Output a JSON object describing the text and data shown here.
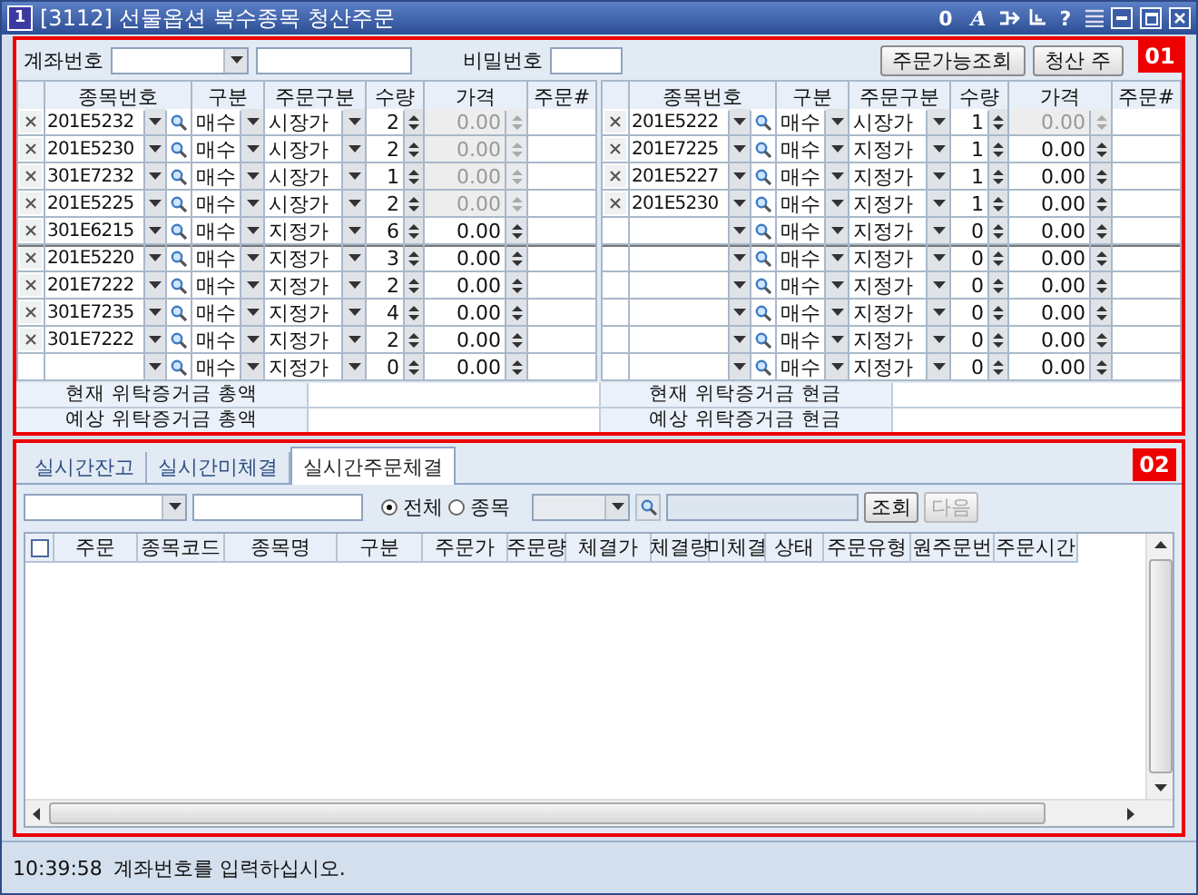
{
  "window": {
    "app_icon": "1",
    "title": "[3112] 선물옵션 복수종목 청산주문",
    "tools": [
      {
        "kind": "text",
        "label": "0",
        "italic": false
      },
      {
        "kind": "text",
        "label": "A",
        "italic": true
      },
      {
        "kind": "link"
      },
      {
        "kind": "pin"
      },
      {
        "kind": "text",
        "label": "?",
        "italic": false
      },
      {
        "kind": "menu"
      }
    ]
  },
  "order_panel": {
    "badge": "01",
    "account_label": "계좌번호",
    "password_label": "비밀번호",
    "buttons": [
      "주문가능조회",
      "청산 주"
    ],
    "tables": [
      {
        "columns": [
          "종목번호",
          "구분",
          "주문구분",
          "수량",
          "가격",
          "주문#"
        ],
        "rows": [
          {
            "removable": true,
            "code": "201E5232",
            "side": "매수",
            "order_type": "시장가",
            "qty": "2",
            "price": "0.00",
            "price_disabled": true
          },
          {
            "removable": true,
            "code": "201E5230",
            "side": "매수",
            "order_type": "시장가",
            "qty": "2",
            "price": "0.00",
            "price_disabled": true
          },
          {
            "removable": true,
            "code": "301E7232",
            "side": "매수",
            "order_type": "시장가",
            "qty": "1",
            "price": "0.00",
            "price_disabled": true
          },
          {
            "removable": true,
            "code": "201E5225",
            "side": "매수",
            "order_type": "시장가",
            "qty": "2",
            "price": "0.00",
            "price_disabled": true
          },
          {
            "removable": true,
            "code": "301E6215",
            "side": "매수",
            "order_type": "지정가",
            "qty": "6",
            "price": "0.00",
            "price_disabled": false
          },
          {
            "removable": true,
            "code": "201E5220",
            "side": "매수",
            "order_type": "지정가",
            "qty": "3",
            "price": "0.00",
            "price_disabled": false
          },
          {
            "removable": true,
            "code": "201E7222",
            "side": "매수",
            "order_type": "지정가",
            "qty": "2",
            "price": "0.00",
            "price_disabled": false
          },
          {
            "removable": true,
            "code": "301E7235",
            "side": "매수",
            "order_type": "지정가",
            "qty": "4",
            "price": "0.00",
            "price_disabled": false
          },
          {
            "removable": true,
            "code": "301E7222",
            "side": "매수",
            "order_type": "지정가",
            "qty": "2",
            "price": "0.00",
            "price_disabled": false
          },
          {
            "removable": false,
            "side": "매수",
            "order_type": "지정가",
            "qty": "0",
            "price": "0.00",
            "price_disabled": false
          }
        ]
      },
      {
        "columns": [
          "종목번호",
          "구분",
          "주문구분",
          "수량",
          "가격",
          "주문#"
        ],
        "rows": [
          {
            "removable": true,
            "code": "201E5222",
            "side": "매수",
            "order_type": "시장가",
            "qty": "1",
            "price": "0.00",
            "price_disabled": true
          },
          {
            "removable": true,
            "code": "201E7225",
            "side": "매수",
            "order_type": "지정가",
            "qty": "1",
            "price": "0.00",
            "price_disabled": false
          },
          {
            "removable": true,
            "code": "201E5227",
            "side": "매수",
            "order_type": "지정가",
            "qty": "1",
            "price": "0.00",
            "price_disabled": false
          },
          {
            "removable": true,
            "code": "201E5230",
            "side": "매수",
            "order_type": "지정가",
            "qty": "1",
            "price": "0.00",
            "price_disabled": false
          },
          {
            "removable": false,
            "side": "매수",
            "order_type": "지정가",
            "qty": "0",
            "price": "0.00",
            "price_disabled": false
          },
          {
            "removable": false,
            "side": "매수",
            "order_type": "지정가",
            "qty": "0",
            "price": "0.00",
            "price_disabled": false
          },
          {
            "removable": false,
            "side": "매수",
            "order_type": "지정가",
            "qty": "0",
            "price": "0.00",
            "price_disabled": false
          },
          {
            "removable": false,
            "side": "매수",
            "order_type": "지정가",
            "qty": "0",
            "price": "0.00",
            "price_disabled": false
          },
          {
            "removable": false,
            "side": "매수",
            "order_type": "지정가",
            "qty": "0",
            "price": "0.00",
            "price_disabled": false
          },
          {
            "removable": false,
            "side": "매수",
            "order_type": "지정가",
            "qty": "0",
            "price": "0.00",
            "price_disabled": false
          }
        ]
      }
    ],
    "summary_rows": [
      [
        "현재 위탁증거금 총액",
        "현재 위탁증거금 현금"
      ],
      [
        "예상 위탁증거금 총액",
        "예상 위탁증거금 현금"
      ]
    ]
  },
  "realtime_panel": {
    "badge": "02",
    "tabs": [
      {
        "label": "실시간잔고",
        "selected": false
      },
      {
        "label": "실시간미체결",
        "selected": false
      },
      {
        "label": "실시간주문체결",
        "selected": true
      }
    ],
    "radios": [
      {
        "label": "전체",
        "selected": true
      },
      {
        "label": "종목",
        "selected": false
      }
    ],
    "buttons": [
      {
        "label": "조회",
        "disabled": false
      },
      {
        "label": "다음",
        "disabled": true
      }
    ],
    "select_all_checked": false,
    "columns": [
      "주문",
      "종목코드",
      "종목명",
      "구분",
      "주문가",
      "주문량",
      "체결가",
      "체결량",
      "미체결",
      "상태",
      "주문유형",
      "원주문번",
      "주문시간"
    ]
  },
  "status_bar": {
    "time": "10:39:58",
    "message": "계좌번호를 입력하십시오."
  }
}
